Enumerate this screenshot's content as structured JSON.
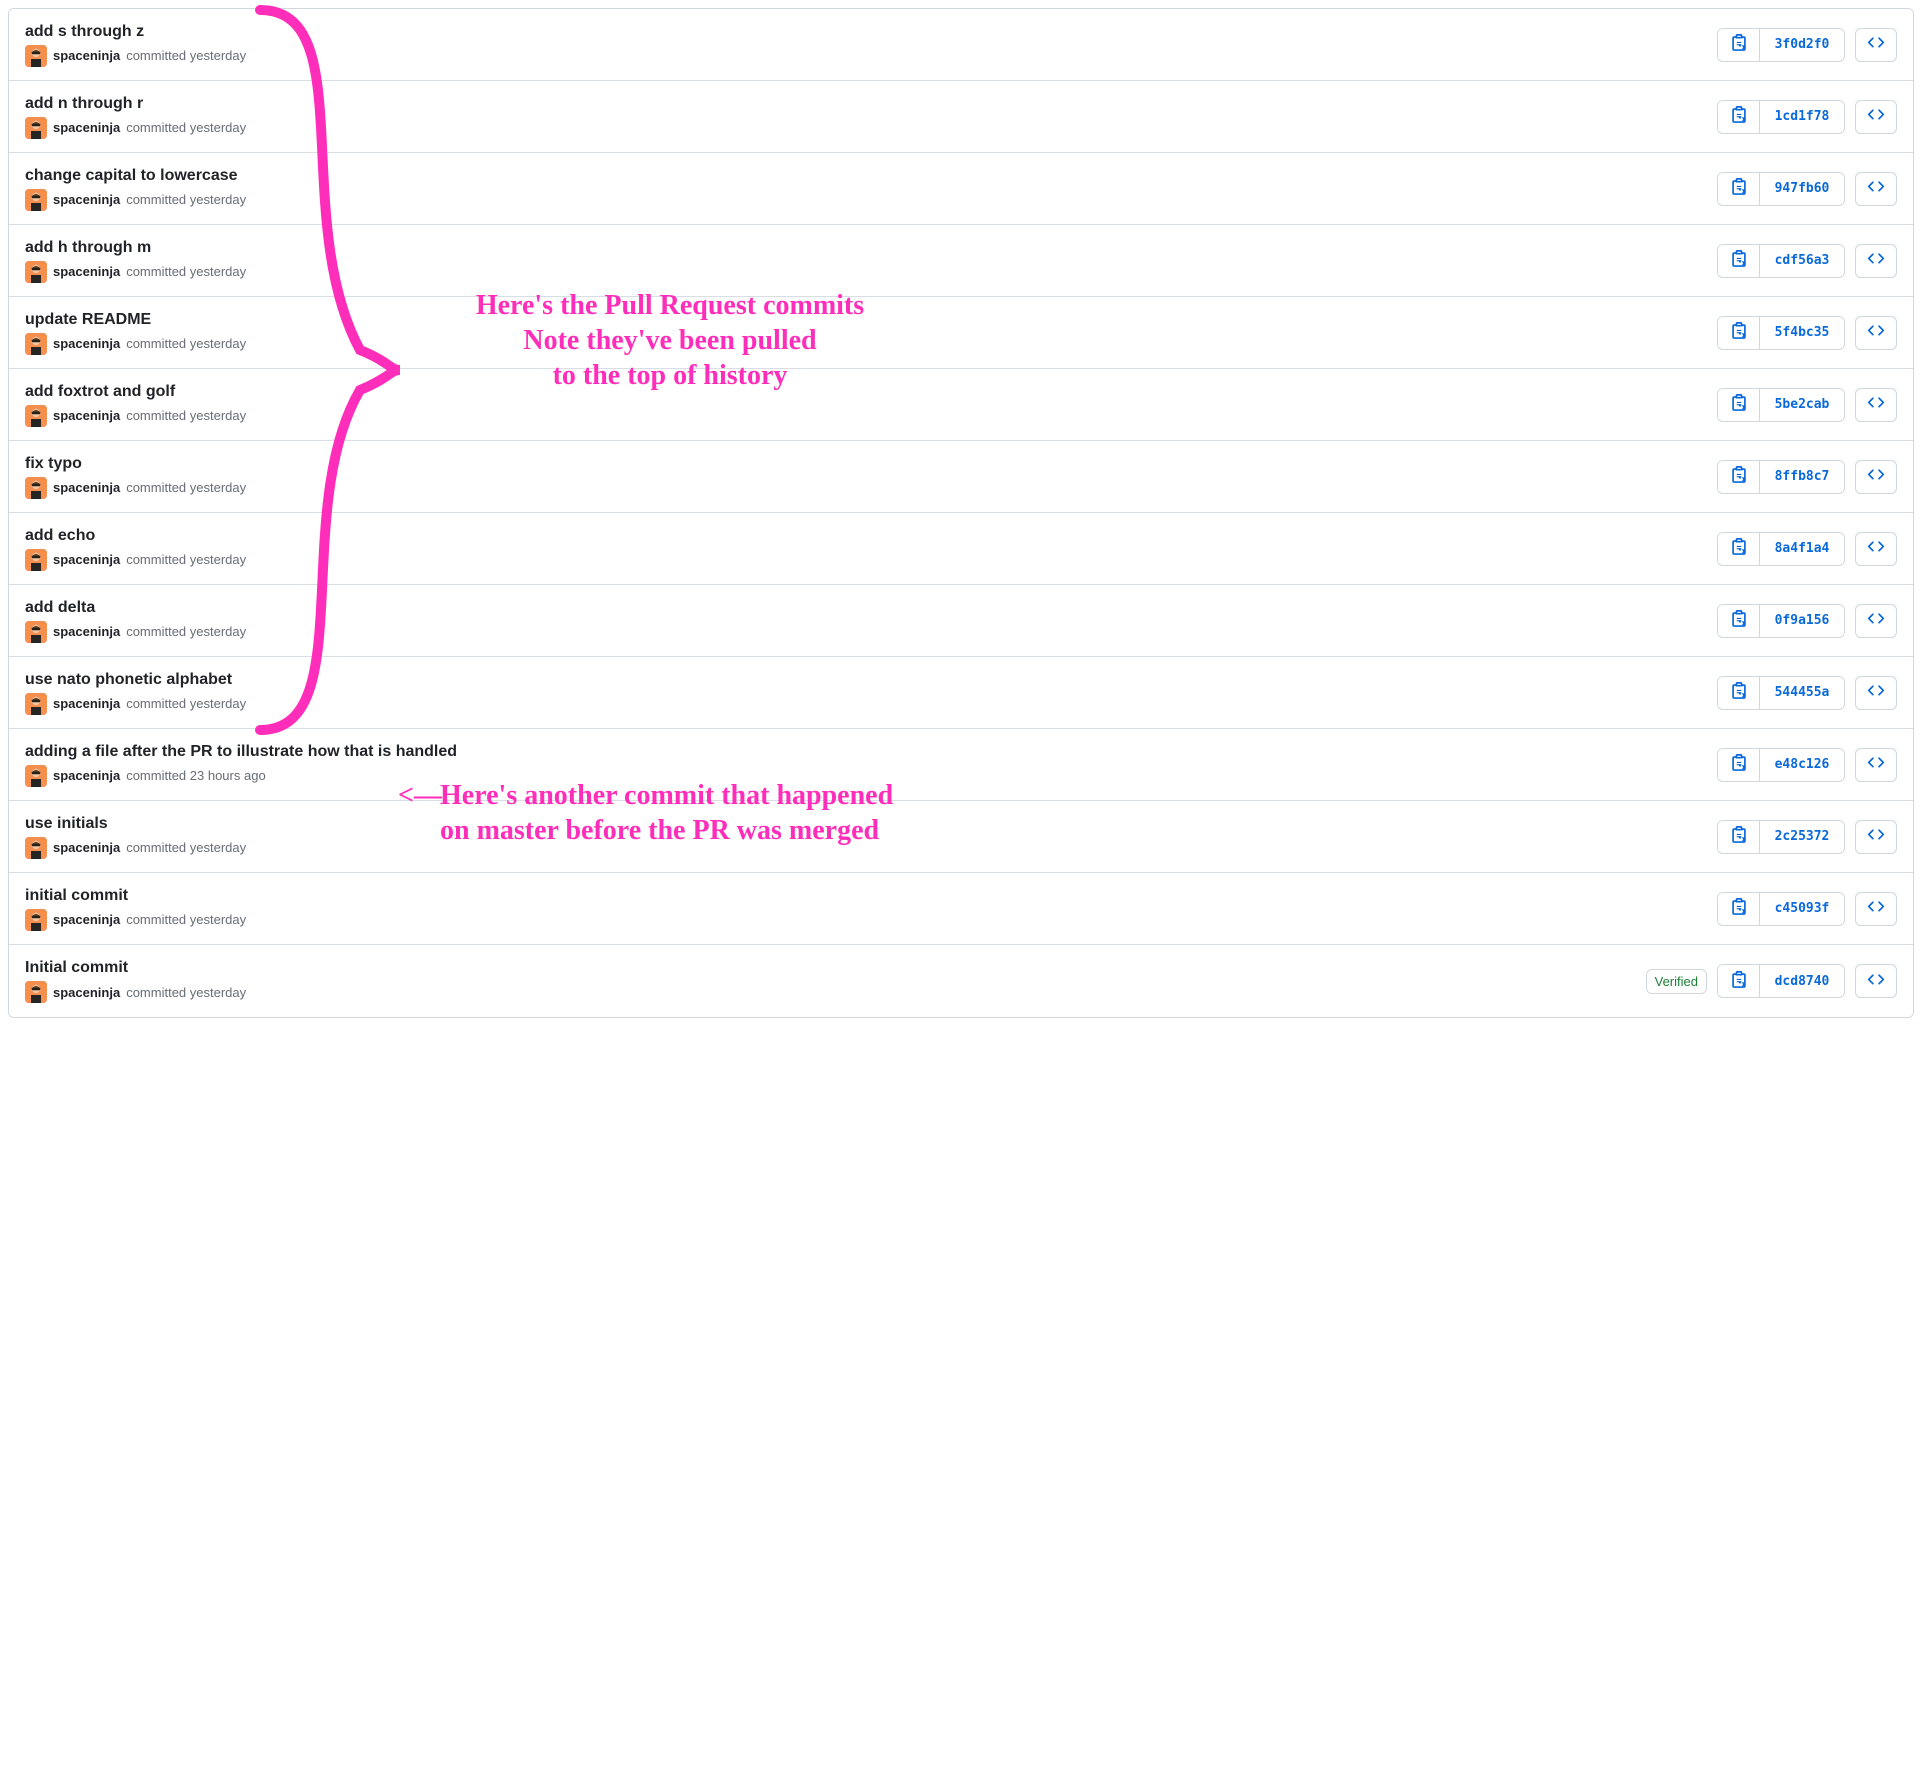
{
  "colors": {
    "link_blue": "#0969da",
    "verified_green": "#1a7f37",
    "annotation_pink": "#ff2eba"
  },
  "commits": [
    {
      "title": "add s through z",
      "author": "spaceninja",
      "timestamp": "committed yesterday",
      "sha": "3f0d2f0",
      "verified": false
    },
    {
      "title": "add n through r",
      "author": "spaceninja",
      "timestamp": "committed yesterday",
      "sha": "1cd1f78",
      "verified": false
    },
    {
      "title": "change capital to lowercase",
      "author": "spaceninja",
      "timestamp": "committed yesterday",
      "sha": "947fb60",
      "verified": false
    },
    {
      "title": "add h through m",
      "author": "spaceninja",
      "timestamp": "committed yesterday",
      "sha": "cdf56a3",
      "verified": false
    },
    {
      "title": "update README",
      "author": "spaceninja",
      "timestamp": "committed yesterday",
      "sha": "5f4bc35",
      "verified": false
    },
    {
      "title": "add foxtrot and golf",
      "author": "spaceninja",
      "timestamp": "committed yesterday",
      "sha": "5be2cab",
      "verified": false
    },
    {
      "title": "fix typo",
      "author": "spaceninja",
      "timestamp": "committed yesterday",
      "sha": "8ffb8c7",
      "verified": false
    },
    {
      "title": "add echo",
      "author": "spaceninja",
      "timestamp": "committed yesterday",
      "sha": "8a4f1a4",
      "verified": false
    },
    {
      "title": "add delta",
      "author": "spaceninja",
      "timestamp": "committed yesterday",
      "sha": "0f9a156",
      "verified": false
    },
    {
      "title": "use nato phonetic alphabet",
      "author": "spaceninja",
      "timestamp": "committed yesterday",
      "sha": "544455a",
      "verified": false
    },
    {
      "title": "adding a file after the PR to illustrate how that is handled",
      "author": "spaceninja",
      "timestamp": "committed 23 hours ago",
      "sha": "e48c126",
      "verified": false
    },
    {
      "title": "use initials",
      "author": "spaceninja",
      "timestamp": "committed yesterday",
      "sha": "2c25372",
      "verified": false
    },
    {
      "title": "initial commit",
      "author": "spaceninja",
      "timestamp": "committed yesterday",
      "sha": "c45093f",
      "verified": false
    },
    {
      "title": "Initial commit",
      "author": "spaceninja",
      "timestamp": "committed yesterday",
      "sha": "dcd8740",
      "verified": true
    }
  ],
  "verified_label": "Verified",
  "annotations": {
    "upper": {
      "line1": "Here's the Pull Request commits",
      "line2": "Note they've been pulled",
      "line3": "to the top of history"
    },
    "lower": {
      "line1": "Here's another commit that happened",
      "line2": "on master before the PR was merged"
    },
    "arrow": "<—"
  }
}
